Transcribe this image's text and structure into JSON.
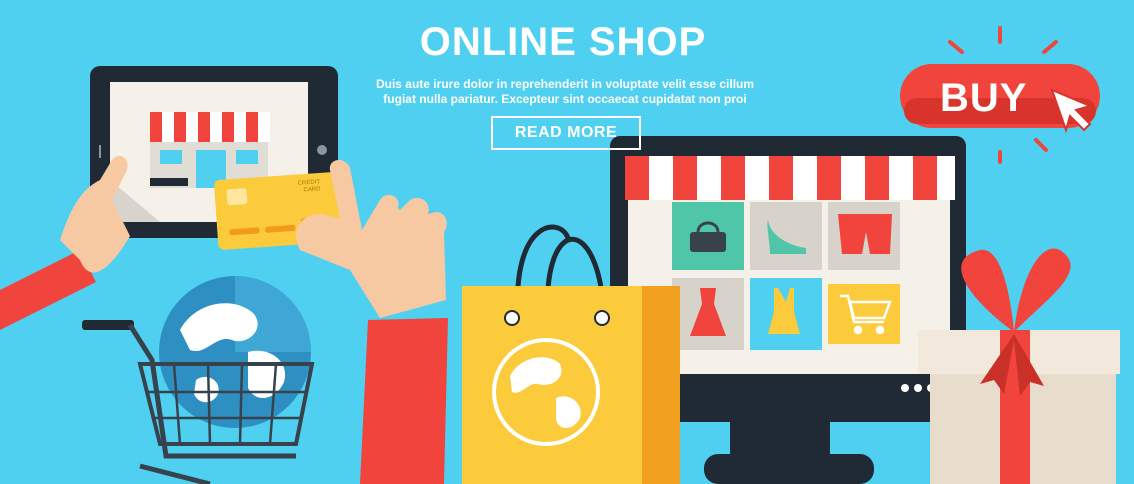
{
  "hero": {
    "title": "ONLINE SHOP",
    "description_line1": "Duis aute irure dolor in reprehenderit in voluptate velit esse cillum",
    "description_line2": "fugiat nulla pariatur. Excepteur sint occaecat cupidatat non proi",
    "cta_label": "READ MORE"
  },
  "buy_badge": {
    "label": "BUY"
  },
  "credit_card": {
    "line1": "CREDIT",
    "line2": "CARD"
  },
  "colors": {
    "background": "#4fd0f0",
    "accent_red": "#f0443c",
    "bag_yellow": "#fccb3b",
    "dark": "#1f2a35",
    "white": "#ffffff"
  },
  "icons": [
    "tablet-icon",
    "shop-storefront-icon",
    "credit-card-icon",
    "globe-icon",
    "shopping-cart-icon",
    "shopping-bag-icon",
    "monitor-icon",
    "handbag-icon",
    "high-heel-icon",
    "shorts-icon",
    "dress-icon",
    "swimsuit-icon",
    "cart-icon",
    "gift-box-icon",
    "cursor-arrow-icon"
  ]
}
